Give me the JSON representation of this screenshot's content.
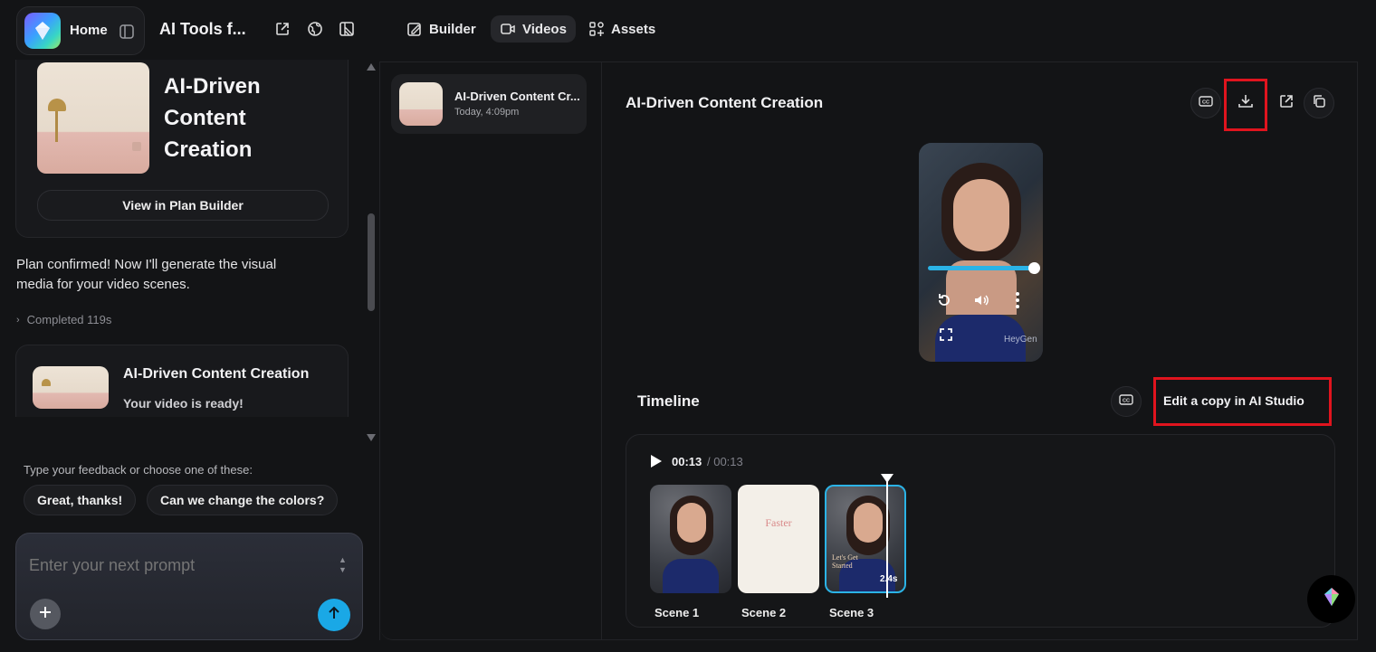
{
  "topbar": {
    "home_label": "Home",
    "project_title": "AI Tools f...",
    "tabs": [
      {
        "label": "Builder",
        "icon": "builder-icon",
        "active": false
      },
      {
        "label": "Videos",
        "icon": "video-camera-icon",
        "active": true
      },
      {
        "label": "Assets",
        "icon": "assets-icon",
        "active": false
      }
    ]
  },
  "chat": {
    "plan_card": {
      "title_line1": "AI-Driven",
      "title_line2": "Content",
      "title_line3": "Creation",
      "button_label": "View in Plan Builder"
    },
    "message": "Plan confirmed! Now I'll generate the visual media for your video scenes.",
    "completed_label": "Completed 119s",
    "video_card": {
      "title": "AI-Driven Content Creation",
      "subtitle": "Your video is ready!"
    },
    "feedback_prompt": "Type your feedback or choose one of these:",
    "suggestions": [
      "Great, thanks!",
      "Can we change the colors?"
    ],
    "input_placeholder": "Enter your next prompt"
  },
  "video_list": {
    "items": [
      {
        "title": "AI-Driven Content Cr...",
        "timestamp": "Today, 4:09pm"
      }
    ]
  },
  "detail": {
    "title": "AI-Driven Content Creation",
    "player": {
      "progress": 0.99,
      "watermark": "HeyGen"
    },
    "timeline": {
      "label": "Timeline",
      "edit_button_label": "Edit a copy in AI Studio",
      "current_time": "00:13",
      "total_time": "/ 00:13",
      "playhead_label": "2.4s",
      "scenes": [
        {
          "label": "Scene 1"
        },
        {
          "label": "Scene 2",
          "overlay_text": "Faster"
        },
        {
          "label": "Scene 3",
          "overlay_text": "Let's Get Started"
        }
      ]
    }
  },
  "colors": {
    "accent": "#2bb3e6",
    "highlight": "#e0141e",
    "send_button": "#1aa8e6"
  }
}
